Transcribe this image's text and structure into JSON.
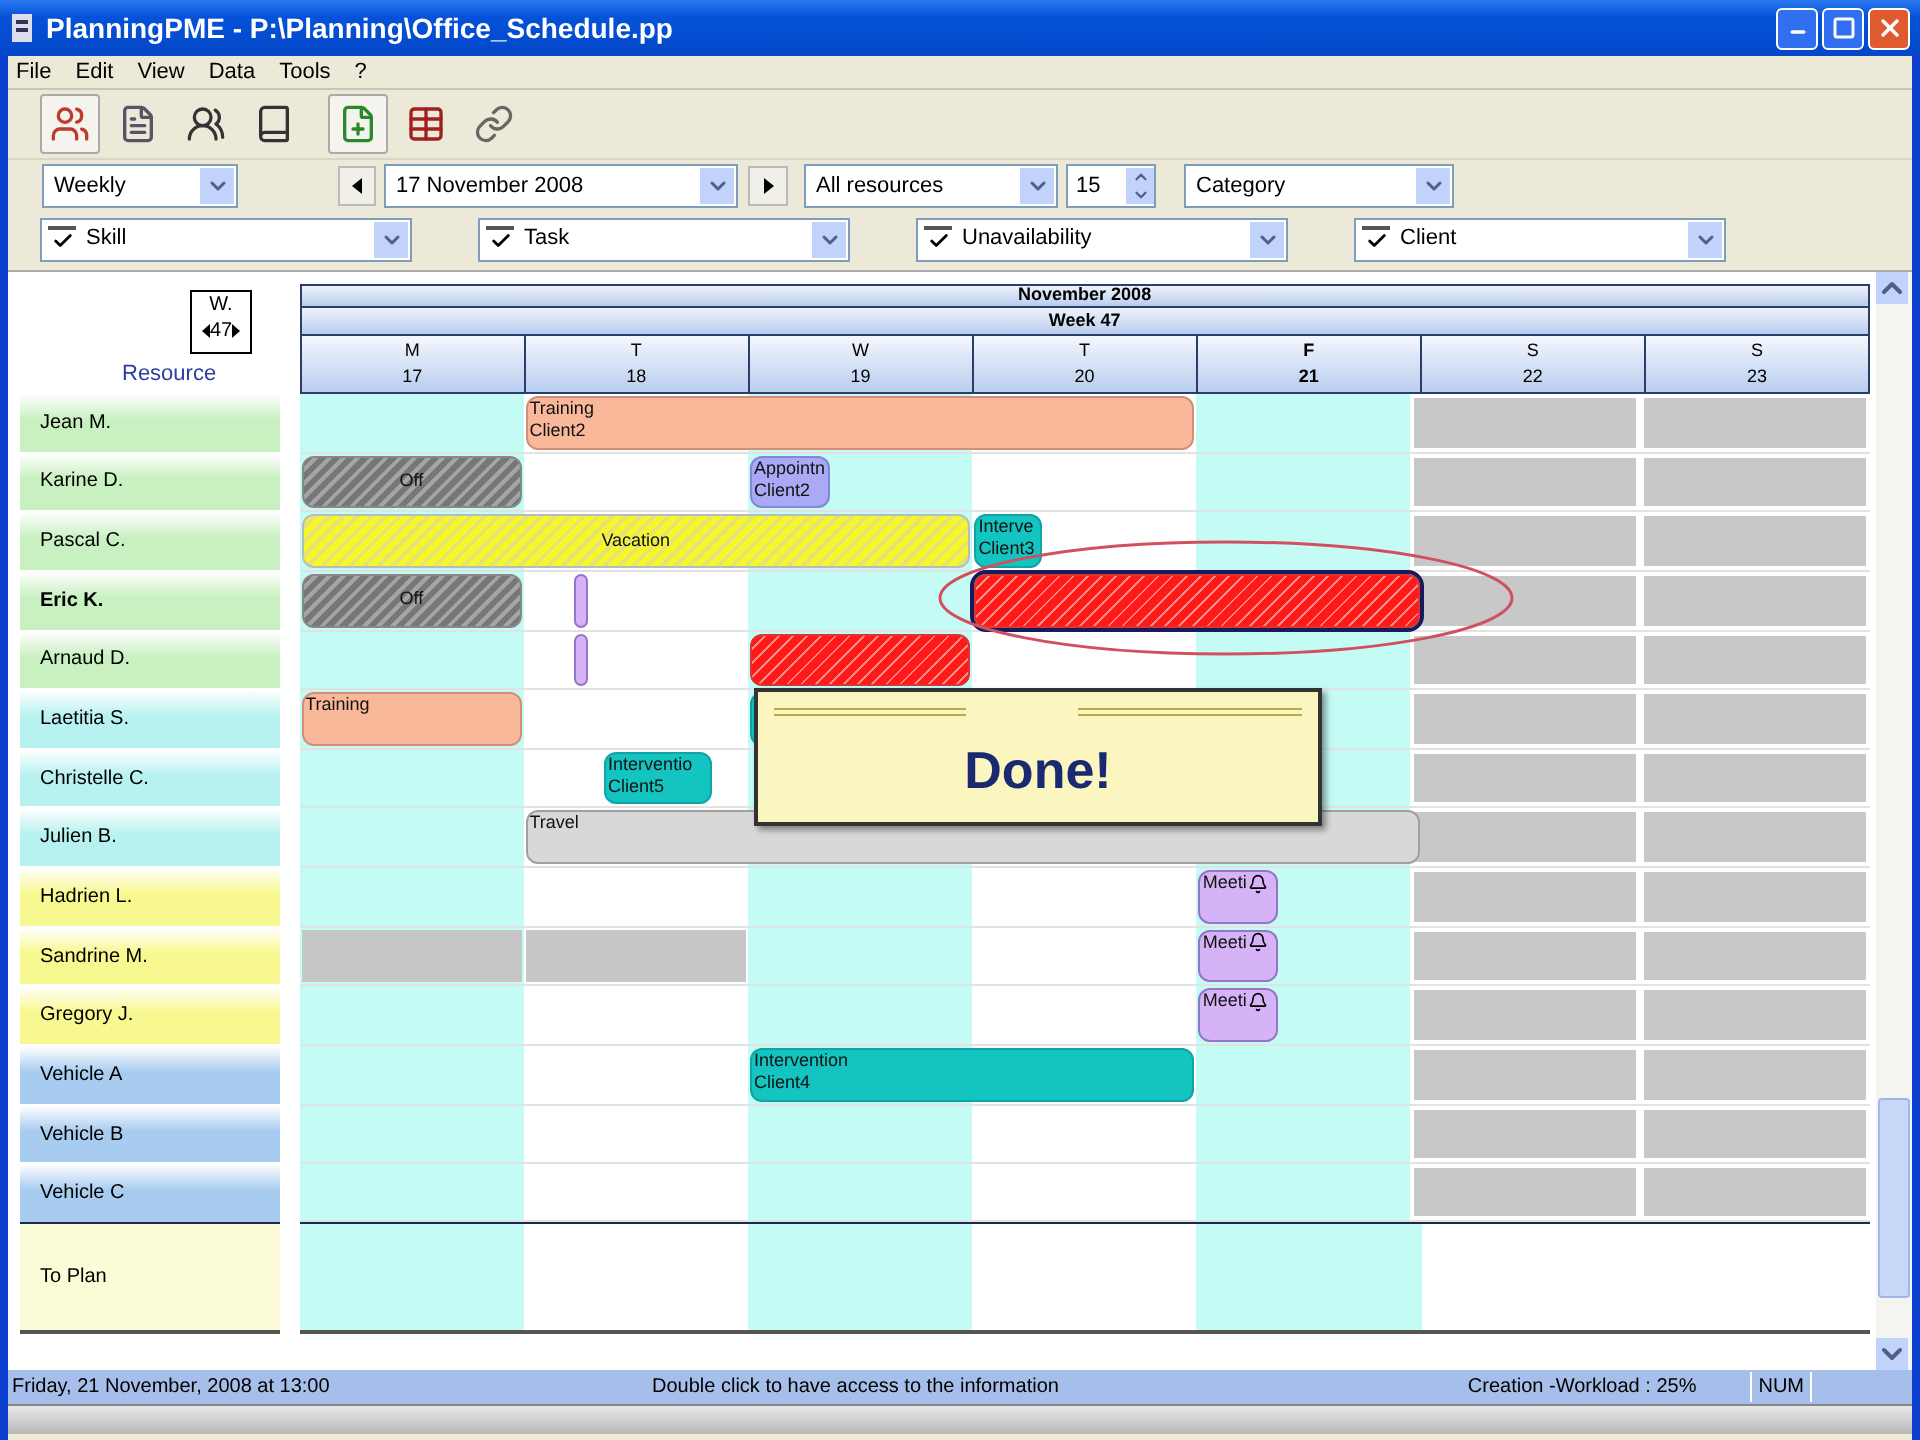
{
  "window": {
    "title": "PlanningPME - P:\\Planning\\Office_Schedule.pp"
  },
  "menu": [
    "File",
    "Edit",
    "View",
    "Data",
    "Tools",
    "?"
  ],
  "toolbar": [
    {
      "kind": "resources",
      "pressed": true
    },
    {
      "kind": "document",
      "pressed": false
    },
    {
      "kind": "people",
      "pressed": false
    },
    {
      "kind": "binder",
      "pressed": false
    },
    {
      "kind": "new",
      "pressed": true
    },
    {
      "kind": "table",
      "pressed": false
    },
    {
      "kind": "link",
      "pressed": false
    }
  ],
  "navigation": {
    "view": "Weekly",
    "date": "17 November 2008",
    "resources": "All resources",
    "count": "15",
    "category": "Category"
  },
  "filters": [
    {
      "label": "Skill",
      "checked": true
    },
    {
      "label": "Task",
      "checked": true
    },
    {
      "label": "Unavailability",
      "checked": true
    },
    {
      "label": "Client",
      "checked": true
    }
  ],
  "calendar": {
    "week_box": {
      "label": "W.",
      "number": "47"
    },
    "resource_heading": "Resource",
    "month": "November 2008",
    "week": "Week 47",
    "days": [
      {
        "letter": "M",
        "date": "17",
        "today": false,
        "weekend": false
      },
      {
        "letter": "T",
        "date": "18",
        "today": false,
        "weekend": false
      },
      {
        "letter": "W",
        "date": "19",
        "today": false,
        "weekend": false
      },
      {
        "letter": "T",
        "date": "20",
        "today": false,
        "weekend": false
      },
      {
        "letter": "F",
        "date": "21",
        "today": true,
        "weekend": false
      },
      {
        "letter": "S",
        "date": "22",
        "today": false,
        "weekend": true
      },
      {
        "letter": "S",
        "date": "23",
        "today": false,
        "weekend": true
      }
    ],
    "resources": [
      {
        "name": "Jean M.",
        "selected": false,
        "color": "#c8f0c0",
        "events": [
          {
            "kind": "training",
            "title": "Training",
            "subtitle": "Client2",
            "selected": false
          }
        ]
      },
      {
        "name": "Karine D.",
        "selected": false,
        "color": "#c8f0c0",
        "events": [
          {
            "kind": "off",
            "title": "Off",
            "selected": false
          },
          {
            "kind": "appointment",
            "title": "Appointn",
            "subtitle": "Client2",
            "selected": false
          }
        ]
      },
      {
        "name": "Pascal C.",
        "selected": false,
        "color": "#c8f0c0",
        "events": [
          {
            "kind": "vacation",
            "title": "Vacation",
            "selected": false
          },
          {
            "kind": "intervention",
            "title": "Interve",
            "subtitle": "Client3",
            "selected": false
          }
        ]
      },
      {
        "name": "Eric K.",
        "selected": true,
        "color": "#c8f0c0",
        "events": [
          {
            "kind": "off",
            "title": "Off",
            "selected": false
          },
          {
            "kind": "task",
            "selected": false
          },
          {
            "kind": "absence",
            "selected": true
          }
        ]
      },
      {
        "name": "Arnaud D.",
        "selected": false,
        "color": "#c8f0c0",
        "events": [
          {
            "kind": "task",
            "selected": false
          },
          {
            "kind": "absence",
            "selected": false
          }
        ]
      },
      {
        "name": "Laetitia S.",
        "selected": false,
        "color": "#b8f2f0",
        "events": [
          {
            "kind": "training",
            "title": "Training",
            "selected": false
          },
          {
            "kind": "intervention",
            "selected": false
          }
        ]
      },
      {
        "name": "Christelle C.",
        "selected": false,
        "color": "#b8f2f0",
        "events": [
          {
            "kind": "intervention",
            "title": "Interventio",
            "subtitle": "Client5",
            "selected": false
          }
        ]
      },
      {
        "name": "Julien B.",
        "selected": false,
        "color": "#b8f2f0",
        "events": [
          {
            "kind": "travel",
            "title": "Travel",
            "selected": false
          }
        ]
      },
      {
        "name": "Hadrien L.",
        "selected": false,
        "color": "#f8f890",
        "events": [
          {
            "kind": "meeting",
            "title": "Meeti",
            "selected": false
          }
        ]
      },
      {
        "name": "Sandrine M.",
        "selected": false,
        "color": "#f8f890",
        "events": [
          {
            "kind": "blocked",
            "selected": false
          },
          {
            "kind": "blocked",
            "selected": false
          },
          {
            "kind": "meeting",
            "title": "Meeti",
            "selected": false
          }
        ]
      },
      {
        "name": "Gregory J.",
        "selected": false,
        "color": "#f8f890",
        "events": [
          {
            "kind": "meeting",
            "title": "Meeti",
            "selected": false
          }
        ]
      },
      {
        "name": "Vehicle A",
        "selected": false,
        "color": "#a8ccf0",
        "events": [
          {
            "kind": "intervention",
            "title": "Intervention",
            "subtitle": "Client4",
            "selected": false
          }
        ]
      },
      {
        "name": "Vehicle B",
        "selected": false,
        "color": "#a8ccf0"
      },
      {
        "name": "Vehicle C",
        "selected": false,
        "color": "#a8ccf0"
      }
    ],
    "to_plan": {
      "label": "To Plan",
      "color": "#fbfbd8"
    }
  },
  "popup": {
    "text": "Done!"
  },
  "status_bar": {
    "date": "Friday, 21 November, 2008 at 13:00",
    "hint": "Double click to have access to the information",
    "workload": "Creation -Workload : 25%",
    "num": "NUM"
  }
}
